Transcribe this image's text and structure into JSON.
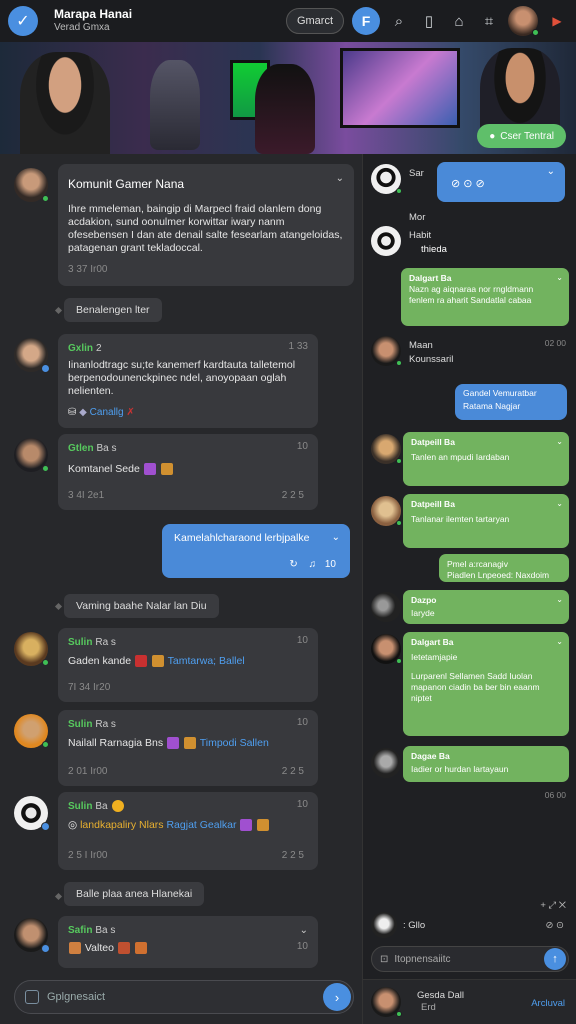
{
  "header": {
    "title": "Marapa Hanai",
    "subtitle": "Verad Gmxa",
    "search_label": "Gmarct",
    "action_button": "F"
  },
  "banner": {
    "button_label": "Cser Tentral"
  },
  "main": {
    "group_post": {
      "title": "Komunit Gamer Nana",
      "body": "Ihre mmeleman, baingip di Marpecl fraid olanlem dong acdakion, sund oonulmer korwittar iwary nanm ofesebensen I dan ate denail salte fesearlam atangeloidas, patagenan grant tekladoccal.",
      "time": "3 37 Ir00"
    },
    "sys1": "Benalengen lter",
    "msg1": {
      "name": "Gxlin",
      "name_suffix": "2",
      "time_right": "1 33",
      "body": "Iinanlodtragc su;te kanemerf kardtauta talletemol berpenodounenckpinec ndel, anoyopaan oglah nelienten.",
      "reaction_label": "Canallg"
    },
    "msg2": {
      "name": "Gtlen",
      "name_suffix": "Ba s",
      "time_right": "10",
      "body": "Komtanel Sede",
      "time": "3 4I 2e1",
      "time_right2": "2 2 5"
    },
    "blue_msg": {
      "body": "Kamelahlcharaond lerbjpalke",
      "meta": "10"
    },
    "sys2": "Vaming baahe Nalar lan Diu",
    "msg3": {
      "name": "Sulin",
      "name_suffix": "Ra s",
      "time_right": "10",
      "body": "Gaden kande",
      "mention": "Tamtarwa; Ballel",
      "time": "7I 34 Ir20"
    },
    "msg4": {
      "name": "Sulin",
      "name_suffix": "Ra s",
      "time_right": "10",
      "body": "Nailall Rarnagia Bns",
      "mention": "Timpodi Sallen",
      "time": "2 01 Ir00",
      "time_right2": "2 2 5"
    },
    "msg5": {
      "name": "Sulin",
      "name_suffix": "Ba",
      "time_right": "10",
      "body_yellow": "landkapaliry Nlars",
      "mention": "Ragjat Gealkar",
      "time": "2 5 I Ir00",
      "time_right2": "2 2 5"
    },
    "sys3": "Balle plaa anea Hlanekai",
    "msg6": {
      "name": "Safin",
      "name_suffix": "Ba s",
      "body": "Valteo",
      "time_right": "10"
    },
    "composer_placeholder": "Gplgnesaict"
  },
  "side": {
    "items": [
      {
        "name": "Sar",
        "text": ""
      },
      {
        "name": "Mor",
        "text": "Habit",
        "sub": "thieda"
      },
      {
        "name": "Dalgart Ba",
        "text": "Nazn ag aiqnaraa nor rngldmann fenlem ra aharit Sandatlal cabaa"
      },
      {
        "name": "Maan",
        "text": "Kounssaril",
        "time": "02 00"
      },
      {
        "name": "Gandel Vemuratbar",
        "text": "Ratama Nagjar"
      },
      {
        "name": "Datpeill Ba",
        "text": "Tanlen an mpudi Iardaban"
      },
      {
        "name": "Datpeill Ba",
        "text": "Tanlanar ilemten tartaryan"
      },
      {
        "name": "Pmel a:rcanagiv",
        "text": "Piadlen Lnpeoed: Naxdoim"
      },
      {
        "name": "Dazpo",
        "text": "Iaryde"
      },
      {
        "name": "Dalgart Ba",
        "text": "Ietetamjapie",
        "body": "Lurparenl Sellamen Sadd Iuolan mapanon ciadin ba ber bin eaanm niptet"
      },
      {
        "name": "Dagae Ba",
        "text": "Iadier or hurdan lartayaun"
      }
    ],
    "time_bottom": "06 00",
    "compose_label": ": Gllo",
    "input_placeholder": "Itopnensaiitc",
    "footer_name": "Gesda Dall",
    "footer_sub": "Erd",
    "footer_action": "Arcluval"
  },
  "colors": {
    "accent": "#4a8fe0",
    "green": "#57c95e",
    "bubble_green": "#72b35f"
  }
}
